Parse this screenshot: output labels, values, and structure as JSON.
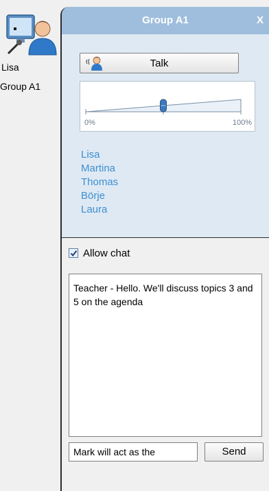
{
  "user": {
    "name": "Lisa",
    "group": "Group A1"
  },
  "panel": {
    "title": "Group A1",
    "close_label": "X",
    "talk_label": "Talk",
    "volume": {
      "min_label": "0%",
      "max_label": "100%",
      "level": 0.5
    },
    "members": [
      "Lisa",
      "Martina",
      "Thomas",
      "Börje",
      "Laura"
    ]
  },
  "chat": {
    "allow_label": "Allow chat",
    "allow_checked": true,
    "log_text": "Teacher - Hello. We'll discuss topics 3 and 5 on the agenda",
    "input_value": "Mark will act as the",
    "send_label": "Send"
  },
  "colors": {
    "titlebar": "#9fbedd",
    "panel_bg": "#dfe9f3",
    "member_link": "#3d8fd1"
  }
}
